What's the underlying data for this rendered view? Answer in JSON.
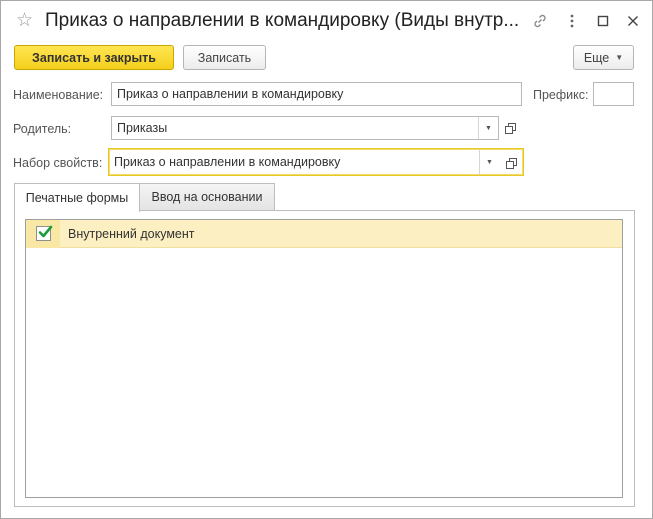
{
  "window": {
    "title": "Приказ о направлении в командировку (Виды внутр...",
    "icons": [
      "star-icon",
      "link-icon",
      "more-vertical-icon",
      "maximize-icon",
      "close-icon"
    ]
  },
  "toolbar": {
    "save_close_label": "Записать и закрыть",
    "save_label": "Записать",
    "more_label": "Еще"
  },
  "form": {
    "name_label": "Наименование:",
    "name_value": "Приказ о направлении в командировку",
    "prefix_label": "Префикс:",
    "prefix_value": "",
    "parent_label": "Родитель:",
    "parent_value": "Приказы",
    "property_set_label": "Набор свойств:",
    "property_set_value": "Приказ о направлении в командировку"
  },
  "tabs": [
    {
      "label": "Печатные формы",
      "active": true
    },
    {
      "label": "Ввод на основании",
      "active": false
    }
  ],
  "print_forms": [
    {
      "checked": true,
      "label": "Внутренний документ"
    }
  ],
  "colors": {
    "primary_button": "#f5cf1b",
    "selected_row": "#fcf0c2",
    "check_mark": "#1e9c3a",
    "focus_border": "#e6c72a"
  }
}
